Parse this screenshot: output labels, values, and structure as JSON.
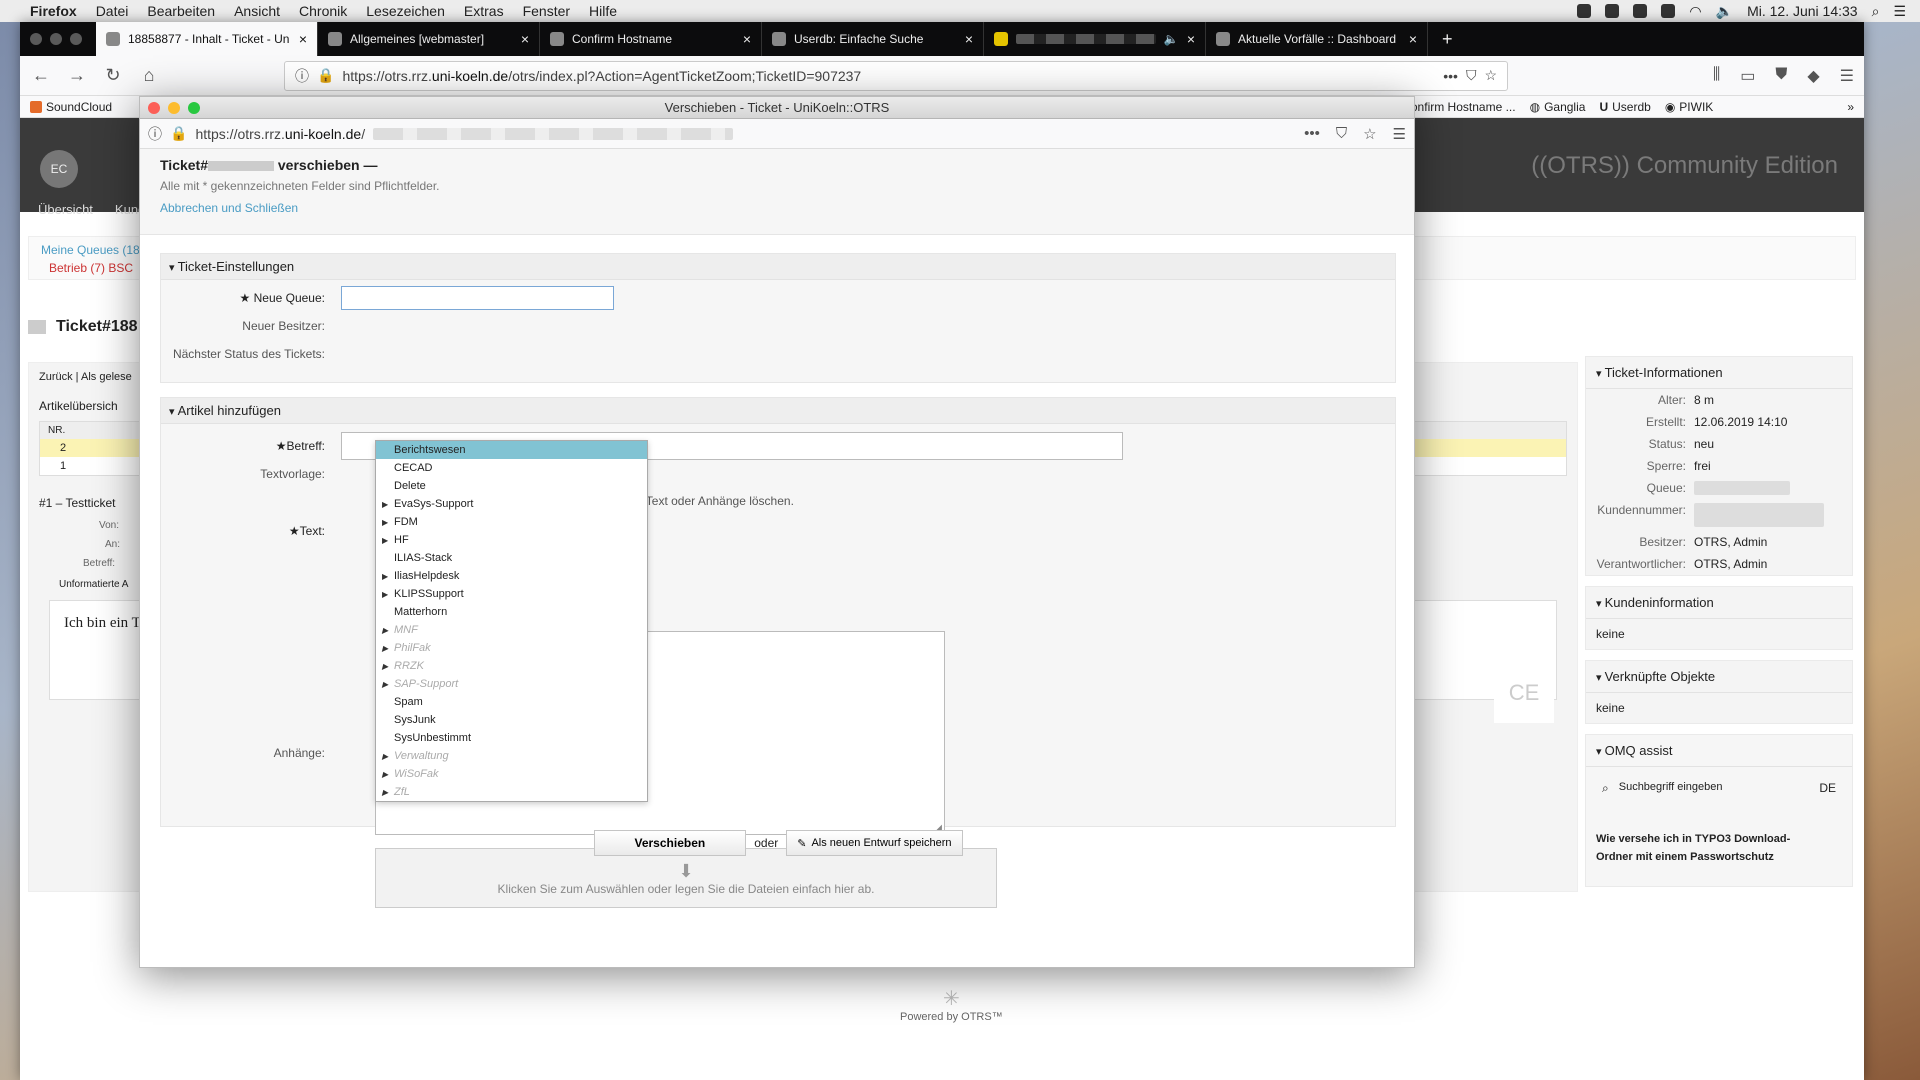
{
  "menubar": {
    "app": "Firefox",
    "items": [
      "Datei",
      "Bearbeiten",
      "Ansicht",
      "Chronik",
      "Lesezeichen",
      "Extras",
      "Fenster",
      "Hilfe"
    ],
    "clock": "Mi. 12. Juni  14:33"
  },
  "tabs": [
    {
      "title": "18858877 - Inhalt - Ticket - Un",
      "active": true
    },
    {
      "title": "Allgemeines [webmaster]"
    },
    {
      "title": "Confirm Hostname"
    },
    {
      "title": "Userdb: Einfache Suche"
    },
    {
      "title": "",
      "censored": true
    },
    {
      "title": "Aktuelle Vorfälle :: Dashboard"
    }
  ],
  "nav": {
    "url_prefix": "https://otrs.rrz.",
    "url_host": "uni-koeln.de",
    "url_rest": "/otrs/index.pl?Action=AgentTicketZoom;TicketID=907237"
  },
  "bookmarks": [
    "SoundCloud",
    "Confirm Hostname ...",
    "Ganglia",
    "Userdb",
    "PIWIK"
  ],
  "otrs": {
    "avatar": "EC",
    "brand": "((OTRS)) Community Edition",
    "nav_items": [
      "Übersicht",
      "Kund"
    ],
    "queue_link": "Meine Queues (18",
    "queue_sub": "Betrieb (7)   BSC",
    "ticket_title": "Ticket#188",
    "back": "Zurück",
    "read": "Als gelese",
    "article_overview": "Artikelübersich",
    "table_head": "NR.",
    "rows": [
      "2",
      "1"
    ],
    "article_title": "#1 – Testticket",
    "von": "Von:",
    "an": "An:",
    "betreff_bg": "Betreff:",
    "unformatted": "Unformatierte A",
    "body_text": "Ich bin ein T",
    "ce": "CE",
    "powered": "Powered by OTRS™"
  },
  "sidebar": {
    "ticket_info_title": "Ticket-Informationen",
    "ticket_info": [
      {
        "k": "Alter:",
        "v": "8 m"
      },
      {
        "k": "Erstellt:",
        "v": "12.06.2019 14:10"
      },
      {
        "k": "Status:",
        "v": "neu"
      },
      {
        "k": "Sperre:",
        "v": "frei"
      },
      {
        "k": "Queue:",
        "v": ""
      },
      {
        "k": "Kundennummer:",
        "v": ""
      },
      {
        "k": "Besitzer:",
        "v": "OTRS, Admin"
      },
      {
        "k": "Verantwortlicher:",
        "v": "OTRS, Admin"
      }
    ],
    "customer_title": "Kundeninformation",
    "customer_value": "keine",
    "linked_title": "Verknüpfte Objekte",
    "linked_value": "keine",
    "omq_title": "OMQ assist",
    "omq_search": "Suchbegriff eingeben",
    "omq_lang": "DE",
    "omq_result": "Wie versehe ich in TYPO3 Download-Ordner mit einem Passwortschutz"
  },
  "dialog": {
    "window_title": "Verschieben - Ticket - UniKoeln::OTRS",
    "url_prefix": "https://otrs.rrz.",
    "url_host": "uni-koeln.de",
    "url_rest": "/",
    "heading_prefix": "Ticket#",
    "heading_suffix": " verschieben —",
    "required_note": "Alle mit * gekennzeichneten Felder sind Pflichtfelder.",
    "cancel_link": "Abbrechen und Schließen",
    "settings_title": "Ticket-Einstellungen",
    "new_queue_label": "★ Neue Queue:",
    "new_owner_label": "Neuer Besitzer:",
    "next_state_label": "Nächster Status des Tickets:",
    "add_article_title": "Artikel hinzufügen",
    "subject_label": "★Betreff:",
    "template_label": "Textvorlage:",
    "template_hint": "n Text oder Anhänge löschen.",
    "text_label": "★Text:",
    "attach_label": "Anhänge:",
    "attach_hint": "Klicken Sie zum Auswählen oder legen Sie die Dateien einfach hier ab.",
    "move_button": "Verschieben",
    "or": "oder",
    "draft_button": "Als neuen Entwurf speichern"
  },
  "queue_options": [
    {
      "label": "Berichtswesen",
      "selected": true,
      "arrow": false,
      "disabled": false
    },
    {
      "label": "CECAD",
      "arrow": false,
      "disabled": false
    },
    {
      "label": "Delete",
      "arrow": false,
      "disabled": false
    },
    {
      "label": "EvaSys-Support",
      "arrow": true,
      "disabled": false
    },
    {
      "label": "FDM",
      "arrow": true,
      "disabled": false
    },
    {
      "label": "HF",
      "arrow": true,
      "disabled": false
    },
    {
      "label": "ILIAS-Stack",
      "arrow": false,
      "disabled": false
    },
    {
      "label": "IliasHelpdesk",
      "arrow": true,
      "disabled": false
    },
    {
      "label": "KLIPSSupport",
      "arrow": true,
      "disabled": false
    },
    {
      "label": "Matterhorn",
      "arrow": false,
      "disabled": false
    },
    {
      "label": "MNF",
      "arrow": true,
      "disabled": true
    },
    {
      "label": "PhilFak",
      "arrow": true,
      "disabled": true
    },
    {
      "label": "RRZK",
      "arrow": true,
      "disabled": true
    },
    {
      "label": "SAP-Support",
      "arrow": true,
      "disabled": true
    },
    {
      "label": "Spam",
      "arrow": false,
      "disabled": false
    },
    {
      "label": "SysJunk",
      "arrow": false,
      "disabled": false
    },
    {
      "label": "SysUnbestimmt",
      "arrow": false,
      "disabled": false
    },
    {
      "label": "Verwaltung",
      "arrow": true,
      "disabled": true
    },
    {
      "label": "WiSoFak",
      "arrow": true,
      "disabled": true
    },
    {
      "label": "ZfL",
      "arrow": true,
      "disabled": true
    }
  ],
  "colors": {
    "selected_option": "#81c3d3",
    "link": "#4a9cc4"
  }
}
